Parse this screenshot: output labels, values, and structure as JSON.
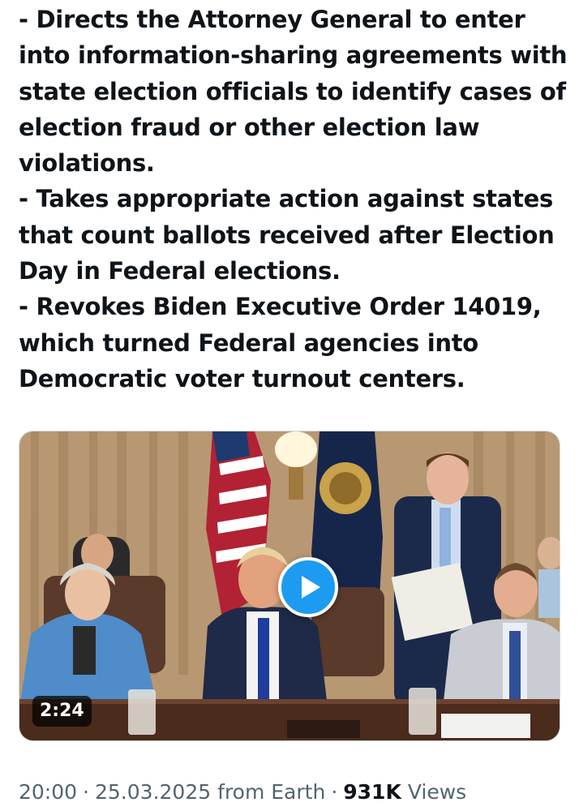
{
  "post": {
    "lines": [
      "- Directs the Attorney General to enter",
      "into information-sharing agreements with",
      "state election officials to identify cases of",
      "election fraud or other election law",
      "violations.",
      "- Takes appropriate action against states",
      "that count ballots received after Election",
      "Day in Federal elections.",
      "- Revokes Biden Executive Order 14019,",
      "which turned Federal agencies into",
      "Democratic voter turnout centers."
    ]
  },
  "video": {
    "duration": "2:24",
    "play_icon": "play-icon"
  },
  "meta": {
    "time": "20:00",
    "separator": "·",
    "date": "25.03.2025",
    "source": "from Earth",
    "views_count": "931K",
    "views_label": "Views"
  },
  "colors": {
    "text": "#0f1419",
    "secondary": "#536471",
    "accent": "#1d9bf0"
  }
}
